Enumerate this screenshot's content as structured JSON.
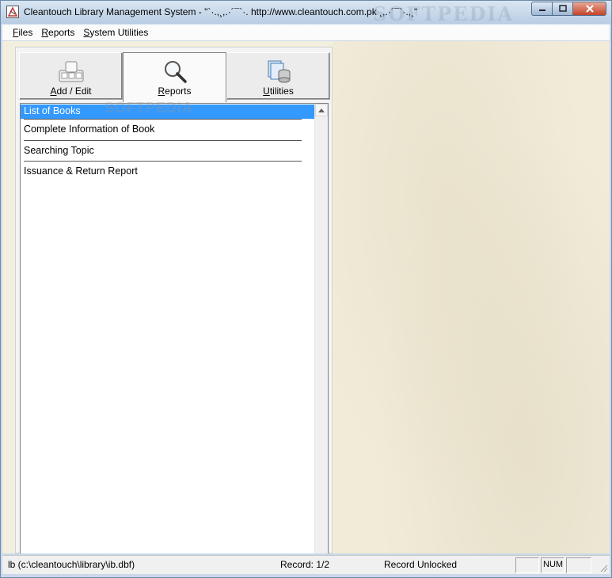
{
  "window": {
    "title": "Cleantouch Library Management System  -  \"`·.,¸,.·´¯`·. http://www.cleantouch.com.pk ¸,.·´¯`·.,¸\"",
    "watermark": "SOFTPEDIA"
  },
  "menubar": {
    "items": [
      {
        "ul": "F",
        "rest": "iles"
      },
      {
        "ul": "R",
        "rest": "eports"
      },
      {
        "ul": "S",
        "rest": "ystem Utilities"
      }
    ]
  },
  "tabs": [
    {
      "pre": "",
      "ul": "A",
      "post": "dd / Edit",
      "icon": "keyboard-icon",
      "active": false
    },
    {
      "pre": "",
      "ul": "R",
      "post": "eports",
      "icon": "magnifier-icon",
      "active": true
    },
    {
      "pre": "",
      "ul": "U",
      "post": "tilities",
      "icon": "database-icon",
      "active": false
    }
  ],
  "report_list": {
    "items": [
      "List of Books",
      "Complete Information of Book",
      "Searching Topic",
      "Issuance & Return Report"
    ],
    "selected_index": 0
  },
  "overlay_watermark": "SOFTPEDIA",
  "statusbar": {
    "file": "lb (c:\\cleantouch\\library\\ib.dbf)",
    "record": "Record: 1/2",
    "lock": "Record Unlocked",
    "num": "NUM"
  },
  "colors": {
    "selection": "#3399ff",
    "close_button": "#c5432a",
    "background": "#f3efdf"
  }
}
